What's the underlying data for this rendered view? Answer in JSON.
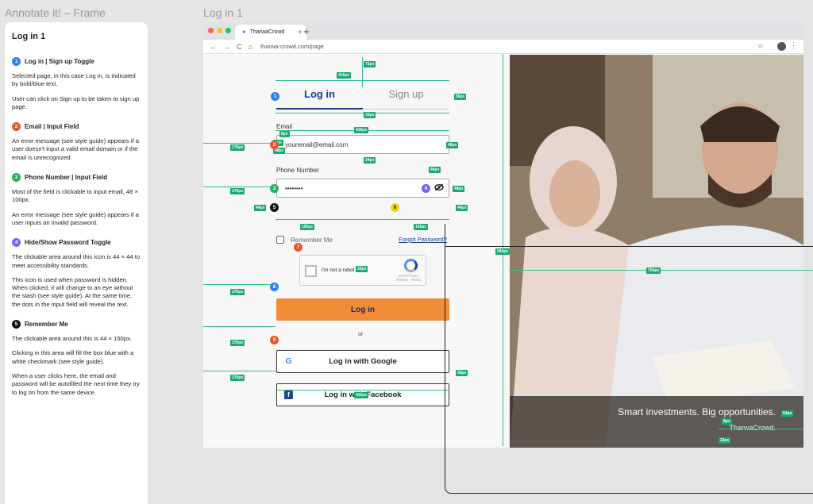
{
  "canvas": {
    "left_frame_label": "Annotate it! – Frame",
    "right_frame_label": "Log in 1"
  },
  "annotations": {
    "title": "Log in 1",
    "items": [
      {
        "num": "1",
        "color": "#2f80ed",
        "heading": "Log in | Sign up Toggle",
        "paragraphs": [
          "Selected page, in this case Log in, is indicated by bold/blue text.",
          "User can click on Sign up to be taken to sign up page."
        ]
      },
      {
        "num": "2",
        "color": "#e8542b",
        "heading": "Email | Input Field",
        "paragraphs": [
          "An error message (see style guide) appears if a user doesn't input a valid email domain or if the email is unrecognized."
        ]
      },
      {
        "num": "3",
        "color": "#27ae60",
        "heading": "Phone Number | Input Field",
        "paragraphs": [
          "Most of the field is clickable to input email, 48 × 100px.",
          "An error message (see style guide) appears if a user inputs an invalid password."
        ]
      },
      {
        "num": "4",
        "color": "#7b61ff",
        "heading": "Hide/Show Password Toggle",
        "paragraphs": [
          "The clickable area around this icon is 44 × 44 to meet accessibility standards.",
          "This icon is used when password is hidden. When clicked, it will change to an eye without the slash (see style guide). At the same time, the dots in the input field will reveal the text."
        ]
      },
      {
        "num": "5",
        "color": "#111111",
        "heading": "Remember Me",
        "paragraphs": [
          "The clickable area around this is 44 × 150px.",
          "Clicking in this area will fill the box blue with a white checkmark (see style guide).",
          "When a user clicks here, the email and password will be autofilled the next time they try to log on from the same device."
        ]
      }
    ]
  },
  "browser": {
    "tab_title": "TharwaCrowd",
    "tab_close": "×",
    "new_tab": "+",
    "url": "tharwa-crowd.com/page",
    "back_icon": "←",
    "forward_icon": "→",
    "reload_icon": "C",
    "home_icon": "⌂",
    "star_icon": "☆",
    "menu_icon": "⋮",
    "dot_colors": [
      "#ff5f57",
      "#febc2e",
      "#28c840"
    ]
  },
  "login": {
    "tab_login": "Log in",
    "tab_signup": "Sign up",
    "email_label": "Email",
    "email_placeholder": "youremail@email.com",
    "phone_label": "Phone Number",
    "password_value": "••••••••",
    "remember_label": "Remember Me",
    "forgot_link": "Forgot Password?",
    "captcha_label": "I'm not a robot",
    "captcha_brand": "reCAPTCHA",
    "captcha_terms": "Privacy - Terms",
    "login_button": "Log in",
    "or_text": "or",
    "google_button": "Log in with Google",
    "facebook_button": "Log in with Facebook",
    "google_icon": "G",
    "facebook_icon": "f",
    "accent": "#f28c38",
    "primary": "#1a3d8f"
  },
  "hero": {
    "tagline": "Smart investments. Big opportunities.",
    "brand": "TharwaCrowd."
  },
  "measurements": {
    "m1": "73px",
    "m2": "416px",
    "m3": "56px",
    "m4": "32px",
    "m5": "416px",
    "m6": "8px",
    "m7": "48px",
    "m8": "176px",
    "m9": "48px",
    "m10": "24px",
    "m11": "44px",
    "m12": "176px",
    "m13": "44px",
    "m14": "44px",
    "m15": "44px",
    "m16": "150px",
    "m17": "126px",
    "m18": "944px",
    "m19": "704px",
    "m20": "32px",
    "m21": "176px",
    "m22": "176px",
    "m23": "176px",
    "m24": "58px",
    "m25": "416px",
    "m26": "64px",
    "m27": "8px",
    "m28": "32px",
    "m29": "8px"
  },
  "markers": {
    "n1": "1",
    "n2": "2",
    "n3": "3",
    "n4": "4",
    "n5": "5",
    "n6": "6",
    "n7": "7",
    "n8": "8",
    "n9": "9"
  }
}
